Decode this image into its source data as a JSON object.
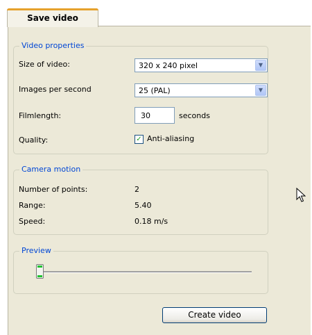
{
  "tab": {
    "label": "Save video"
  },
  "video_properties": {
    "legend": "Video properties",
    "size_label": "Size of video:",
    "size_value": "320 x 240 pixel",
    "fps_label": "Images per second",
    "fps_value": "25 (PAL)",
    "filmlength_label": "Filmlength:",
    "filmlength_value": "30",
    "filmlength_unit": "seconds",
    "quality_label": "Quality:",
    "antialiasing_label": "Anti-aliasing",
    "antialiasing_checked": true
  },
  "camera_motion": {
    "legend": "Camera motion",
    "points_label": "Number of points:",
    "points_value": "2",
    "range_label": "Range:",
    "range_value": "5.40",
    "speed_label": "Speed:",
    "speed_value": "0.18 m/s"
  },
  "preview": {
    "legend": "Preview",
    "slider_position": 0
  },
  "actions": {
    "create_label": "Create video"
  },
  "icons": {
    "dropdown": "chevron-down-icon",
    "check": "check-icon",
    "cursor": "mouse-pointer-icon"
  },
  "colors": {
    "group_legend": "#0046d5",
    "panel_bg": "#ece9d8",
    "tab_highlight": "#e6a12c",
    "slider_grip": "#20c030"
  }
}
